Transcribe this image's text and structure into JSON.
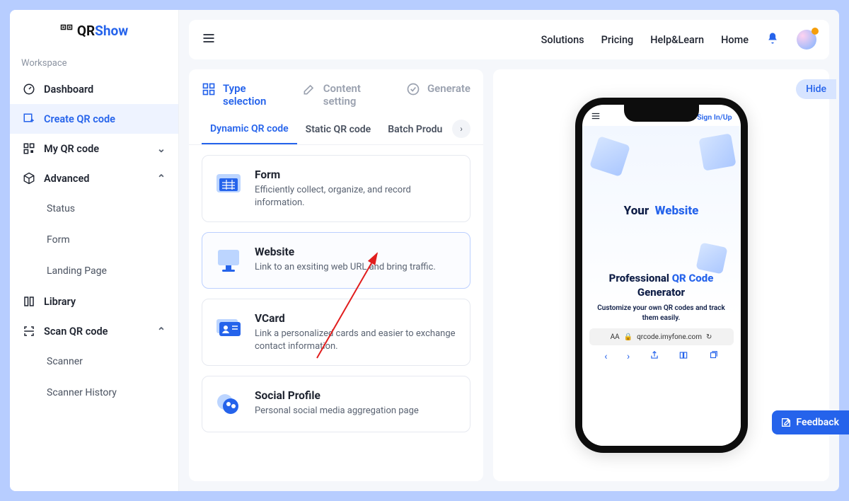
{
  "brand": {
    "part1": "QR",
    "part2": "Show"
  },
  "sidebar": {
    "workspace_label": "Workspace",
    "items": {
      "dashboard": "Dashboard",
      "create": "Create QR code",
      "myqr": "My QR code",
      "advanced": "Advanced",
      "library": "Library",
      "scan": "Scan QR code"
    },
    "advanced_sub": [
      "Status",
      "Form",
      "Landing Page"
    ],
    "scan_sub": [
      "Scanner",
      "Scanner History"
    ]
  },
  "topbar": {
    "links": [
      "Solutions",
      "Pricing",
      "Help&Learn",
      "Home"
    ]
  },
  "steps": {
    "type": "Type selection",
    "content": "Content setting",
    "generate": "Generate"
  },
  "tabs": {
    "dynamic": "Dynamic QR code",
    "static": "Static QR code",
    "batch": "Batch Produ"
  },
  "cards": {
    "form": {
      "title": "Form",
      "desc": "Efficiently collect, organize, and record information."
    },
    "website": {
      "title": "Website",
      "desc": "Link to an exsiting web URL and bring traffic."
    },
    "vcard": {
      "title": "VCard",
      "desc": "Link a personalized cards and easier to exchange contact information."
    },
    "social": {
      "title": "Social Profile",
      "desc": "Personal social media aggregation page"
    }
  },
  "preview": {
    "hide": "Hide",
    "signin": "Sign In/Up",
    "your": "Your",
    "website": "Website",
    "headline_pre": "Professional",
    "headline_blue": "QR Code",
    "headline_post": "Generator",
    "sub": "Customize your own QR codes and track them easily.",
    "addr_aA": "AA",
    "addr_lock": "🔒",
    "addr_url": "qrcode.imyfone.com",
    "addr_reload": "↻"
  },
  "feedback": "Feedback"
}
